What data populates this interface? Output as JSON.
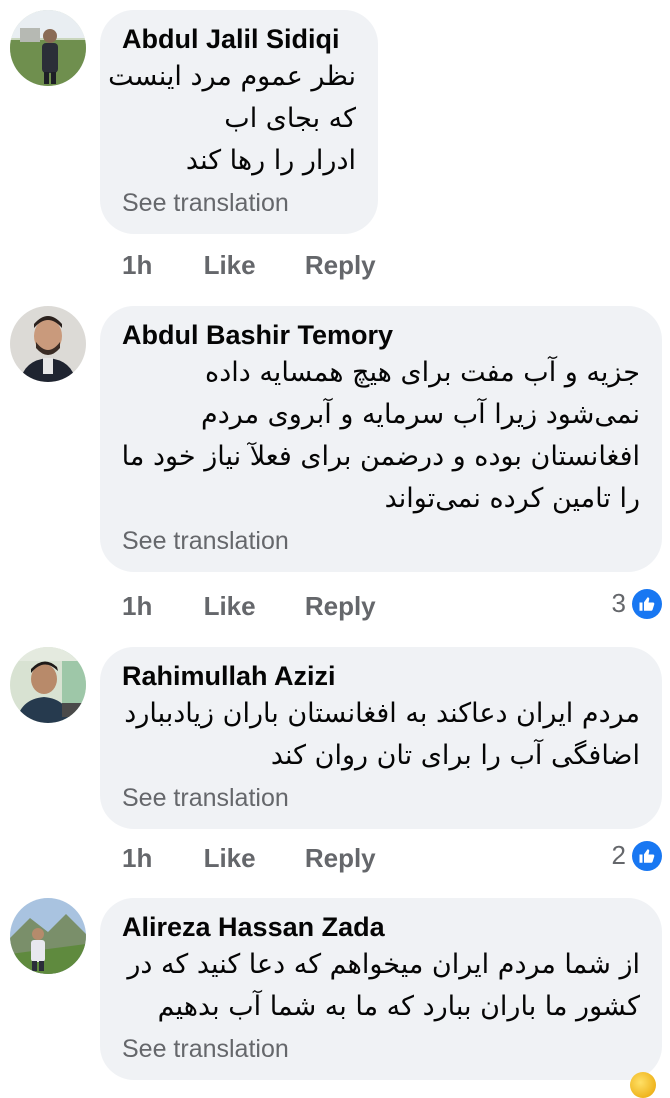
{
  "comments": [
    {
      "author": "Abdul Jalil Sidiqi",
      "lines": [
        "نظر عموم مرد اینست",
        "که بجای اب",
        "ادرار را رها کند"
      ],
      "see_translation": "See translation",
      "time": "1h",
      "like": "Like",
      "reply": "Reply",
      "reaction_count": null
    },
    {
      "author": "Abdul Bashir Temory",
      "lines": [
        "جزیه و آب مفت برای هیچ همسایه داده",
        "نمی‌شود زیرا  آب سرمایه و  آبروی مردم",
        "افغانستان بوده و درضمن برای فعلآ نیاز خود ما",
        "را تامین کرده نمی‌تواند"
      ],
      "see_translation": "See translation",
      "time": "1h",
      "like": "Like",
      "reply": "Reply",
      "reaction_count": "3"
    },
    {
      "author": "Rahimullah Azizi",
      "lines": [
        "مردم ایران دعاکند به افغانستان باران زیادببارد",
        "اضافگی آب را برای تان روان کند"
      ],
      "see_translation": "See translation",
      "time": "1h",
      "like": "Like",
      "reply": "Reply",
      "reaction_count": "2"
    },
    {
      "author": "Alireza Hassan Zada",
      "lines": [
        "از شما مردم ایران میخواهم که دعا کنید که در",
        "کشور ما باران ببارد که ما به شما آب بدهیم"
      ],
      "see_translation": "See translation"
    }
  ],
  "icons": {
    "reaction": "like-thumb-icon"
  },
  "colors": {
    "bubble": "#f0f2f5",
    "secondary_text": "#65676b",
    "like_blue": "#1877f2"
  }
}
